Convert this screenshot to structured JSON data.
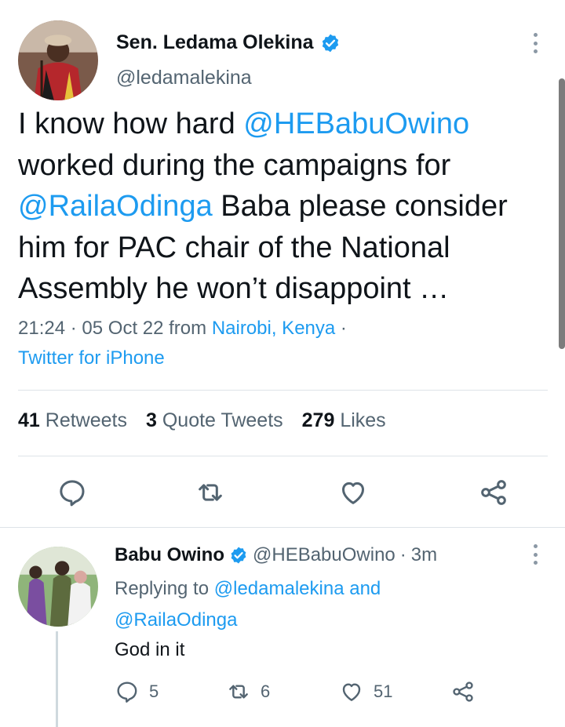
{
  "main_tweet": {
    "author_name": "Sen. Ledama Olekina",
    "author_handle": "@ledamalekina",
    "text_parts": [
      {
        "text": "I know how hard ",
        "link": false
      },
      {
        "text": "@HEBabuOwino",
        "link": true
      },
      {
        "text": " worked during the campaigns for ",
        "link": false
      },
      {
        "text": "@RailaOdinga",
        "link": true
      },
      {
        "text": " Baba please consider him for PAC chair of the National Assembly he won’t disappoint …",
        "link": false
      }
    ],
    "time": "21:24",
    "date": "05 Oct 22",
    "from_label": "from",
    "location": "Nairobi, Kenya",
    "client": "Twitter for iPhone",
    "stats": {
      "retweets_count": "41",
      "retweets_label": "Retweets",
      "quotes_count": "3",
      "quotes_label": "Quote Tweets",
      "likes_count": "279",
      "likes_label": "Likes"
    }
  },
  "reply": {
    "author_name": "Babu Owino",
    "author_handle": "@HEBabuOwino",
    "age": "3m",
    "replying_prefix": "Replying to",
    "replying_user1": "@ledamalekina",
    "replying_and": "and",
    "replying_user2": "@RailaOdinga",
    "text": "God in it",
    "replies_count": "5",
    "retweets_count": "6",
    "likes_count": "51"
  },
  "colors": {
    "link": "#1d9bf0",
    "muted": "#536471",
    "verified": "#1d9bf0"
  }
}
